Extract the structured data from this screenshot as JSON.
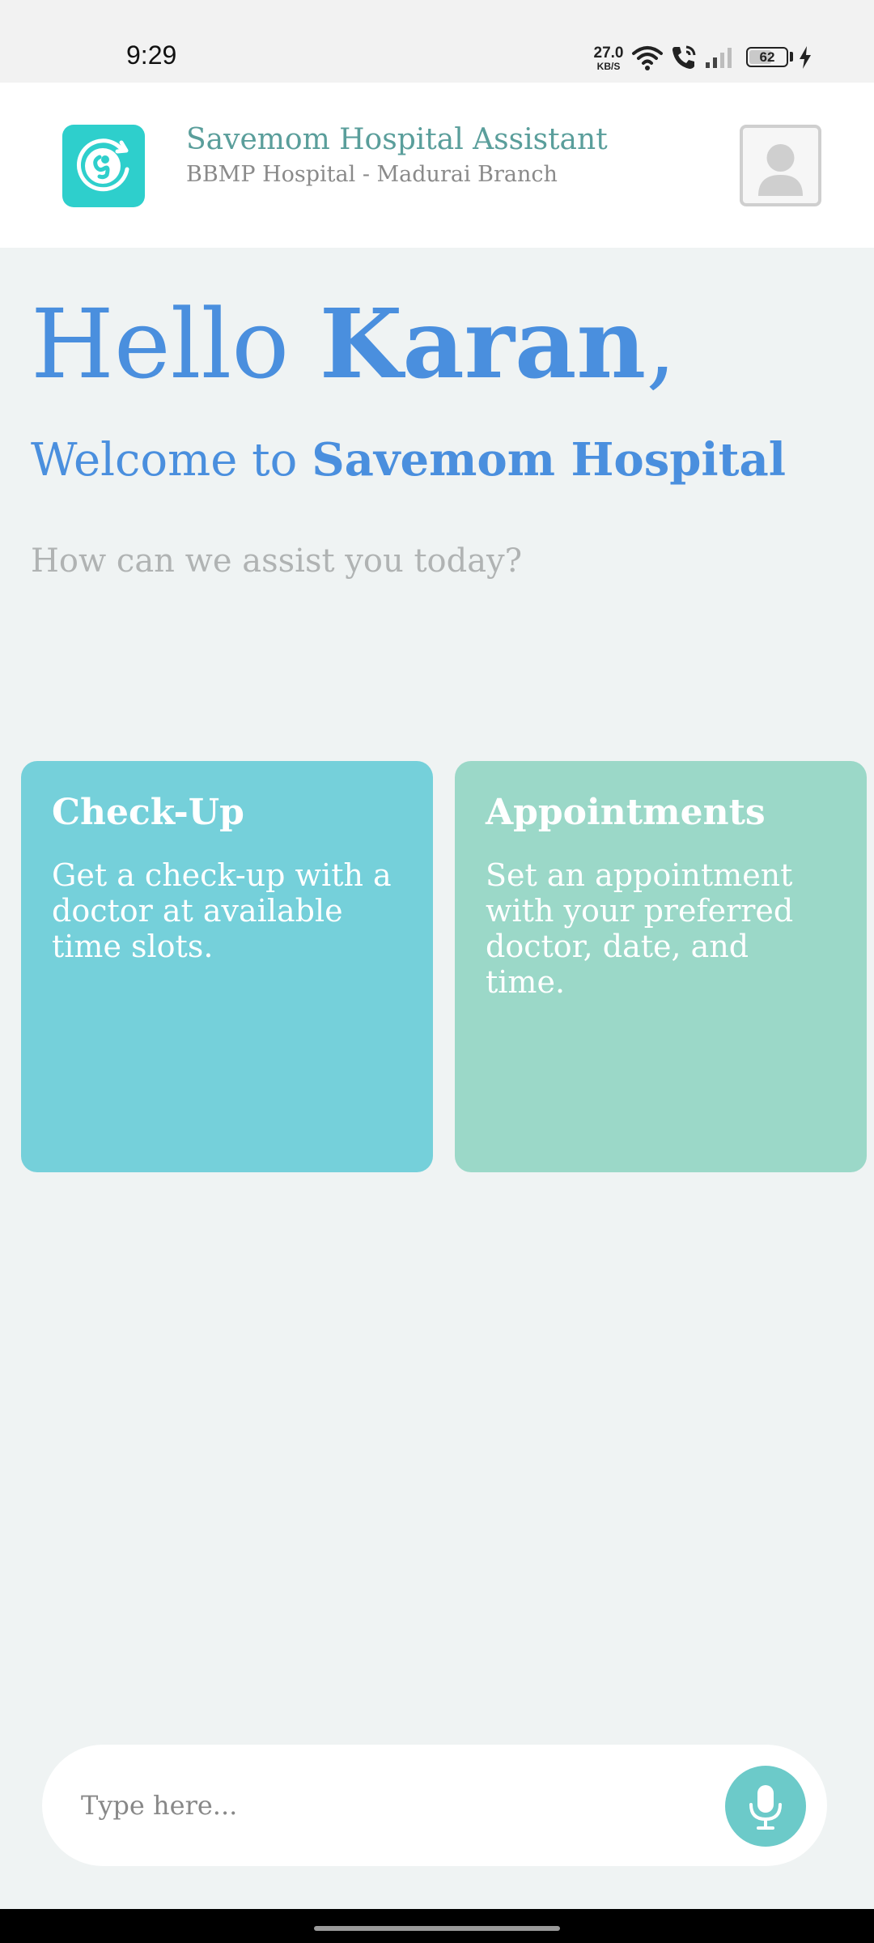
{
  "status_bar": {
    "time": "9:29",
    "network_speed_value": "27.0",
    "network_speed_unit": "KB/S",
    "battery_level": "62",
    "icons": [
      "wifi-icon",
      "call-icon",
      "signal-icon",
      "battery-icon",
      "charging-icon"
    ]
  },
  "header": {
    "title": "Savemom Hospital Assistant",
    "subtitle": "BBMP Hospital - Madurai Branch",
    "logo_icon": "baby-logo-icon",
    "avatar_icon": "user-avatar-icon"
  },
  "greeting": {
    "hello": "Hello ",
    "name": "Karan",
    "comma": ",",
    "welcome_prefix": "Welcome to ",
    "hospital_name": "Savemom Hospital",
    "prompt": "How can we assist you today?"
  },
  "cards": [
    {
      "title": "Check-Up",
      "description": "Get a check-up with a doctor at available time slots.",
      "color": "#75d0da"
    },
    {
      "title": "Appointments",
      "description": "Set an appointment with your preferred doctor, date, and time.",
      "color": "#9bd8c8"
    }
  ],
  "input": {
    "placeholder": "Type here...",
    "value": "",
    "mic_icon": "microphone-icon"
  },
  "colors": {
    "background": "#eff3f3",
    "accent_blue": "#4a8fde",
    "title_teal": "#5a9e9b",
    "logo_teal": "#2ecfcc",
    "mic_teal": "#6ccac9"
  }
}
